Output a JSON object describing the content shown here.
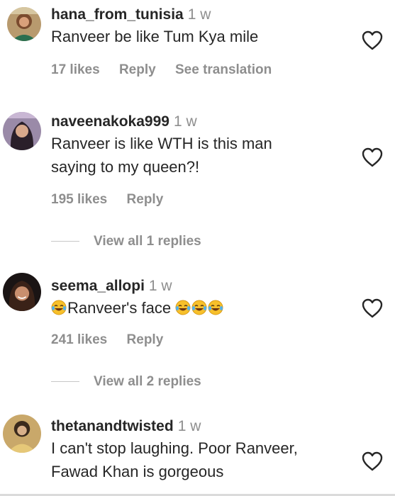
{
  "comments": [
    {
      "username": "hana_from_tunisia",
      "time": "1 w",
      "text": "Ranveer be like Tum Kya mile",
      "likes": "17 likes",
      "reply": "Reply",
      "translate": "See translation"
    },
    {
      "username": "naveenakoka999",
      "time": "1 w",
      "text_line1": "Ranveer is like WTH is this man",
      "text_line2": "saying to my queen?!",
      "likes": "195 likes",
      "reply": "Reply",
      "view_replies": "View all 1 replies"
    },
    {
      "username": "seema_allopi",
      "time": "1 w",
      "text": "Ranveer's face",
      "likes": "241 likes",
      "reply": "Reply",
      "view_replies": "View all 2 replies",
      "emoji": "face-with-tears-of-joy"
    },
    {
      "username": "thetanandtwisted",
      "time": "1 w",
      "text_line1": "I can't stop laughing. Poor Ranveer,",
      "text_line2": "Fawad Khan is gorgeous"
    }
  ],
  "colors": {
    "text": "#262626",
    "muted": "#8e8e8e",
    "divider": "#dbdbdb"
  },
  "icons": {
    "like": "heart-outline-icon",
    "emoji": "face-with-tears-of-joy"
  }
}
